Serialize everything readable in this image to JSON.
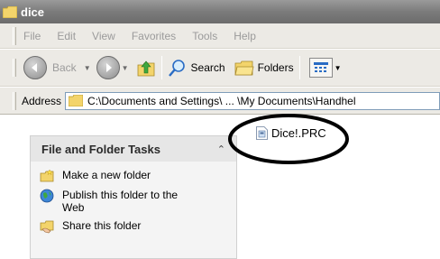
{
  "window": {
    "title": "dice"
  },
  "menu": [
    "File",
    "Edit",
    "View",
    "Favorites",
    "Tools",
    "Help"
  ],
  "toolbar": {
    "back_label": "Back",
    "search_label": "Search",
    "folders_label": "Folders"
  },
  "address": {
    "label": "Address",
    "path": "C:\\Documents and Settings\\ ... \\My Documents\\Handhel"
  },
  "tasks": {
    "header": "File and Folder Tasks",
    "items": [
      {
        "label": "Make a new folder",
        "icon": "new-folder-icon"
      },
      {
        "label": "Publish this folder to the Web",
        "icon": "globe-icon"
      },
      {
        "label": "Share this folder",
        "icon": "share-folder-icon"
      }
    ]
  },
  "files": [
    {
      "name": "Dice!.PRC",
      "icon": "prc-file-icon"
    }
  ],
  "colors": {
    "titlebar": "#7b7b7b",
    "toolbar_bg": "#eceae5",
    "address_border": "#7f9db9",
    "annotation": "#000000"
  }
}
